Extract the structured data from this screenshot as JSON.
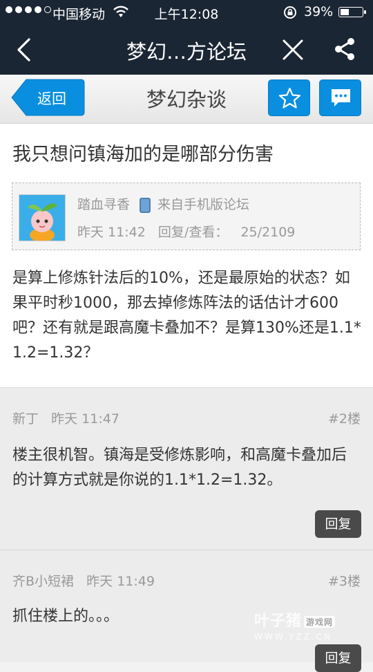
{
  "status_bar": {
    "carrier": "中国移动",
    "time": "上午12:08",
    "battery": "39%"
  },
  "nav": {
    "title": "梦幻…方论坛"
  },
  "subnav": {
    "back_label": "返回",
    "title": "梦幻杂谈"
  },
  "post": {
    "title": "我只想问镇海加的是哪部分伤害",
    "author": "踏血寻香",
    "source": "来自手机版论坛",
    "time": "昨天 11:42",
    "stats_label": "回复/查看：",
    "stats": "25/2109",
    "body": "是算上修炼针法后的10%，还是最原始的状态？如果平时秒1000，那去掉修炼阵法的话估计才600吧？还有就是跟高魔卡叠加不？是算130%还是1.1*1.2=1.32？"
  },
  "replies": [
    {
      "author": "新丁",
      "time": "昨天 11:47",
      "floor": "#2楼",
      "text": "楼主很机智。镇海是受修炼影响，和高魔卡叠加后的计算方式就是你说的1.1*1.2=1.32。",
      "reply_label": "回复"
    },
    {
      "author": "齐B小短裙",
      "time": "昨天 11:49",
      "floor": "#3楼",
      "text": "抓住楼上的。。。",
      "reply_label": "回复"
    }
  ],
  "watermark": {
    "brand": "叶子猪",
    "tag": "游戏网",
    "url": "WWW.YZZ.CN"
  }
}
